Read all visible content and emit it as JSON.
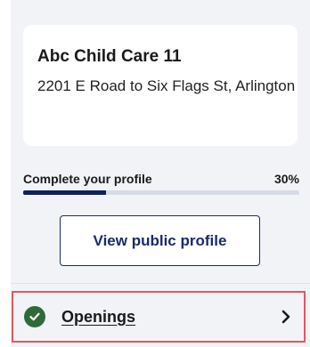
{
  "card": {
    "title": "Abc Child Care 11",
    "address": "2201 E Road to Six Flags St, Arlington"
  },
  "profile_progress": {
    "label": "Complete your profile",
    "percent_text": "30%",
    "value": 0.3
  },
  "actions": {
    "view_public_profile": "View public profile"
  },
  "nav": {
    "openings": {
      "label": "Openings",
      "status": "complete",
      "status_icon": "check-circle-icon",
      "chevron_icon": "chevron-right-icon"
    }
  },
  "colors": {
    "accent": "#1b2a6b",
    "progress_fill": "#10205c",
    "check": "#2e6b3a",
    "highlight": "#e2585d"
  }
}
